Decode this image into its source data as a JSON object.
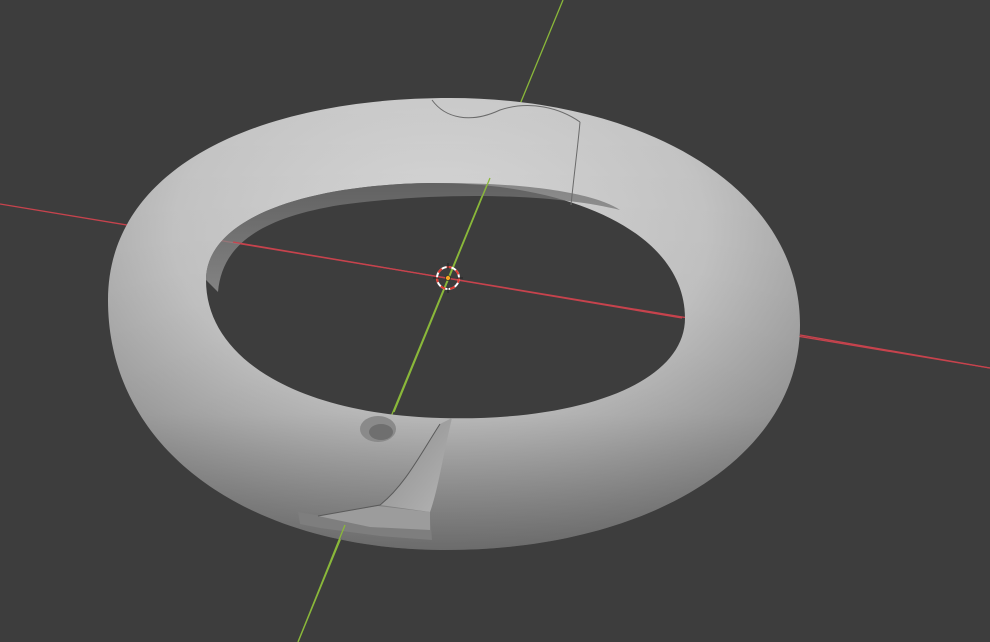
{
  "viewport": {
    "background_color": "#3d3d3d",
    "axis_x_color": "#c7434d",
    "axis_y_color": "#8ab83a",
    "object_color": "#c8c8c8",
    "cursor_color": "#e03c32",
    "origin_color": "#f5a623"
  },
  "icons": {
    "cursor": "3d-cursor-icon",
    "origin": "object-origin-icon"
  }
}
